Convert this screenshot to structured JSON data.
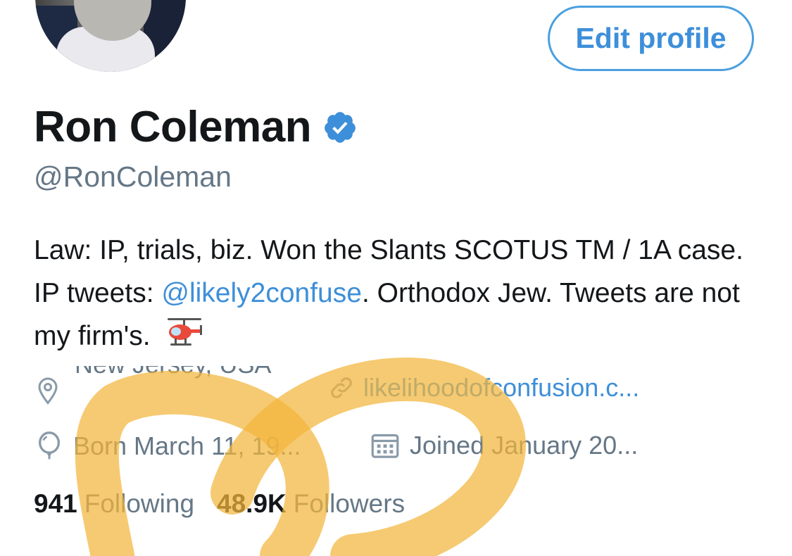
{
  "profile": {
    "edit_button_label": "Edit profile",
    "display_name": "Ron Coleman",
    "verified": true,
    "handle": "@RonColeman",
    "bio": {
      "part1": "Law: IP, trials, biz. Won the Slants SCOTUS TM / 1A case. IP tweets: ",
      "mention": "@likely2confuse",
      "part2": ". Orthodox Jew. Tweets are not my firm's. ",
      "emoji_icon": "helicopter-icon"
    },
    "location": "New Jersey, USA",
    "website": "likelihoodofconfusion.c...",
    "birthday": "Born March 11, 19...",
    "joined": "Joined January 20...",
    "following_count": "941",
    "following_label": "Following",
    "followers_count": "48.9K",
    "followers_label": "Followers"
  },
  "colors": {
    "accent_blue": "#3d8fd9",
    "secondary_text": "#657786",
    "primary_text": "#14171a",
    "marker_yellow": "#f2b63c"
  },
  "icons": [
    "location-icon",
    "link-icon",
    "balloon-icon",
    "calendar-icon",
    "verified-badge-icon",
    "helicopter-icon"
  ]
}
